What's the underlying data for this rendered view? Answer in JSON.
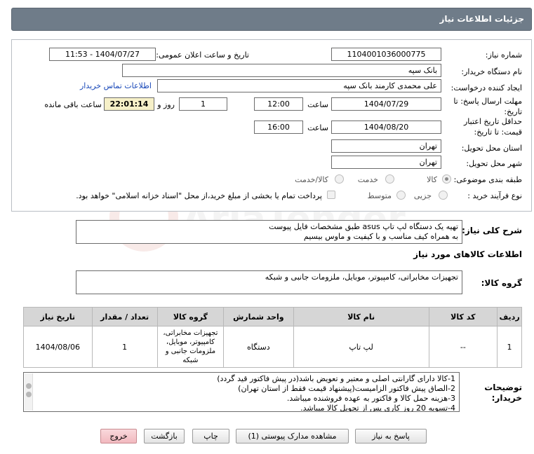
{
  "header": {
    "title": "جزئیات اطلاعات نیاز"
  },
  "form": {
    "need_number_label": "شماره نیاز:",
    "need_number": "1104001036000775",
    "announce_label": "تاریخ و ساعت اعلان عمومی:",
    "announce_value": "1404/07/27 - 11:53",
    "buyer_org_label": "نام دستگاه خریدار:",
    "buyer_org": "بانک سپه",
    "creator_label": "ایجاد کننده درخواست:",
    "creator": "علی محمدی کارمند بانک سپه",
    "buyer_contact_link": "اطلاعات تماس خریدار",
    "reply_deadline_label": "مهلت ارسال پاسخ: تا تاریخ:",
    "reply_date": "1404/07/29",
    "time_label": "ساعت",
    "reply_time": "12:00",
    "days_value": "1",
    "day_and_label": "روز و",
    "remaining_time": "22:01:14",
    "remaining_label": "ساعت باقی مانده",
    "validity_label": "حداقل تاریخ اعتبار قیمت: تا تاریخ:",
    "validity_date": "1404/08/20",
    "validity_time": "16:00",
    "province_label": "استان محل تحویل:",
    "province": "تهران",
    "city_label": "شهر محل تحویل:",
    "city": "تهران",
    "category_label": "طبقه بندی موضوعی:",
    "category_options": [
      "کالا",
      "خدمت",
      "کالا/خدمت"
    ],
    "process_label": "نوع فرآیند خرید :",
    "process_options": [
      "جزیی",
      "متوسط"
    ],
    "payment_note": "پرداخت تمام یا بخشی از مبلغ خرید،از محل \"اسناد خزانه اسلامی\" خواهد بود."
  },
  "description": {
    "label": "شرح کلی نیاز:",
    "text_line1": "تهیه یک دستگاه لپ تاپ asus طبق مشخصات فایل پیوست",
    "text_line2": "به همراه کیف مناسب و با کیفیت و ماوس بیسیم"
  },
  "goods_section": {
    "title": "اطلاعات کالاهای مورد نیاز",
    "group_label": "گروه کالا:",
    "group_value": "تجهیزات مخابراتی، کامپیوتر، موبایل، ملزومات جانبی و شبکه"
  },
  "table": {
    "columns": [
      "ردیف",
      "کد کالا",
      "نام کالا",
      "واحد شمارش",
      "گروه کالا",
      "تعداد / مقدار",
      "تاریخ نیاز"
    ],
    "rows": [
      {
        "row": "1",
        "code": "--",
        "name": "لپ تاپ",
        "unit": "دستگاه",
        "group": "تجهیزات مخابراتی، کامپیوتر، موبایل، ملزومات جانبی و شبکه",
        "qty": "1",
        "date": "1404/08/06"
      }
    ]
  },
  "buyer_notes": {
    "label": "توضیحات خریدار:",
    "lines": [
      "1-کالا دارای گارانتی اصلی و  معتبر و تعویض باشد(در پیش فاکتور قید گردد)",
      "2-الصاق پیش فاکتور الزامیست(پیشنهاد قیمت فقط از استان تهران)",
      "3-هزینه حمل کالا و فاکتور به عهده فروشنده میباشد.",
      "4-تسویه 20 روز کاری پس از تحویل کالا میباشد."
    ]
  },
  "buttons": {
    "reply": "پاسخ به نیاز",
    "attachments": "مشاهده مدارک پیوستی (1)",
    "print": "چاپ",
    "back": "بازگشت",
    "exit": "خروج"
  },
  "watermark_text": "AriaTender.net",
  "colors": {
    "header_bg": "#6f7c89",
    "link": "#1747b8",
    "remaining_bg": "#f6f0c8",
    "exit_button": "#f2b9bf"
  }
}
